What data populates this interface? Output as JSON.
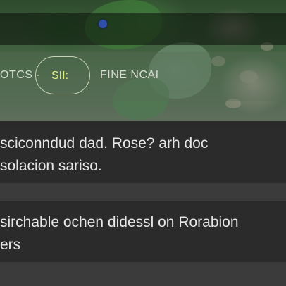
{
  "tabs": {
    "items": [
      {
        "label": "OTCS -"
      },
      {
        "label": "SII:"
      },
      {
        "label": "FINE NCAI"
      }
    ]
  },
  "cards": [
    {
      "lines": [
        "sciconndud dad. Rose? arh doc",
        "solacion sariso."
      ]
    },
    {
      "lines": [
        "sirchable ochen didessl on Rorabion",
        "ers"
      ]
    }
  ],
  "colors": {
    "accent": "#e2f08a",
    "card_bg": "#2b2b2b",
    "separator": "#3b3b3b",
    "text": "#e6e6e6"
  }
}
